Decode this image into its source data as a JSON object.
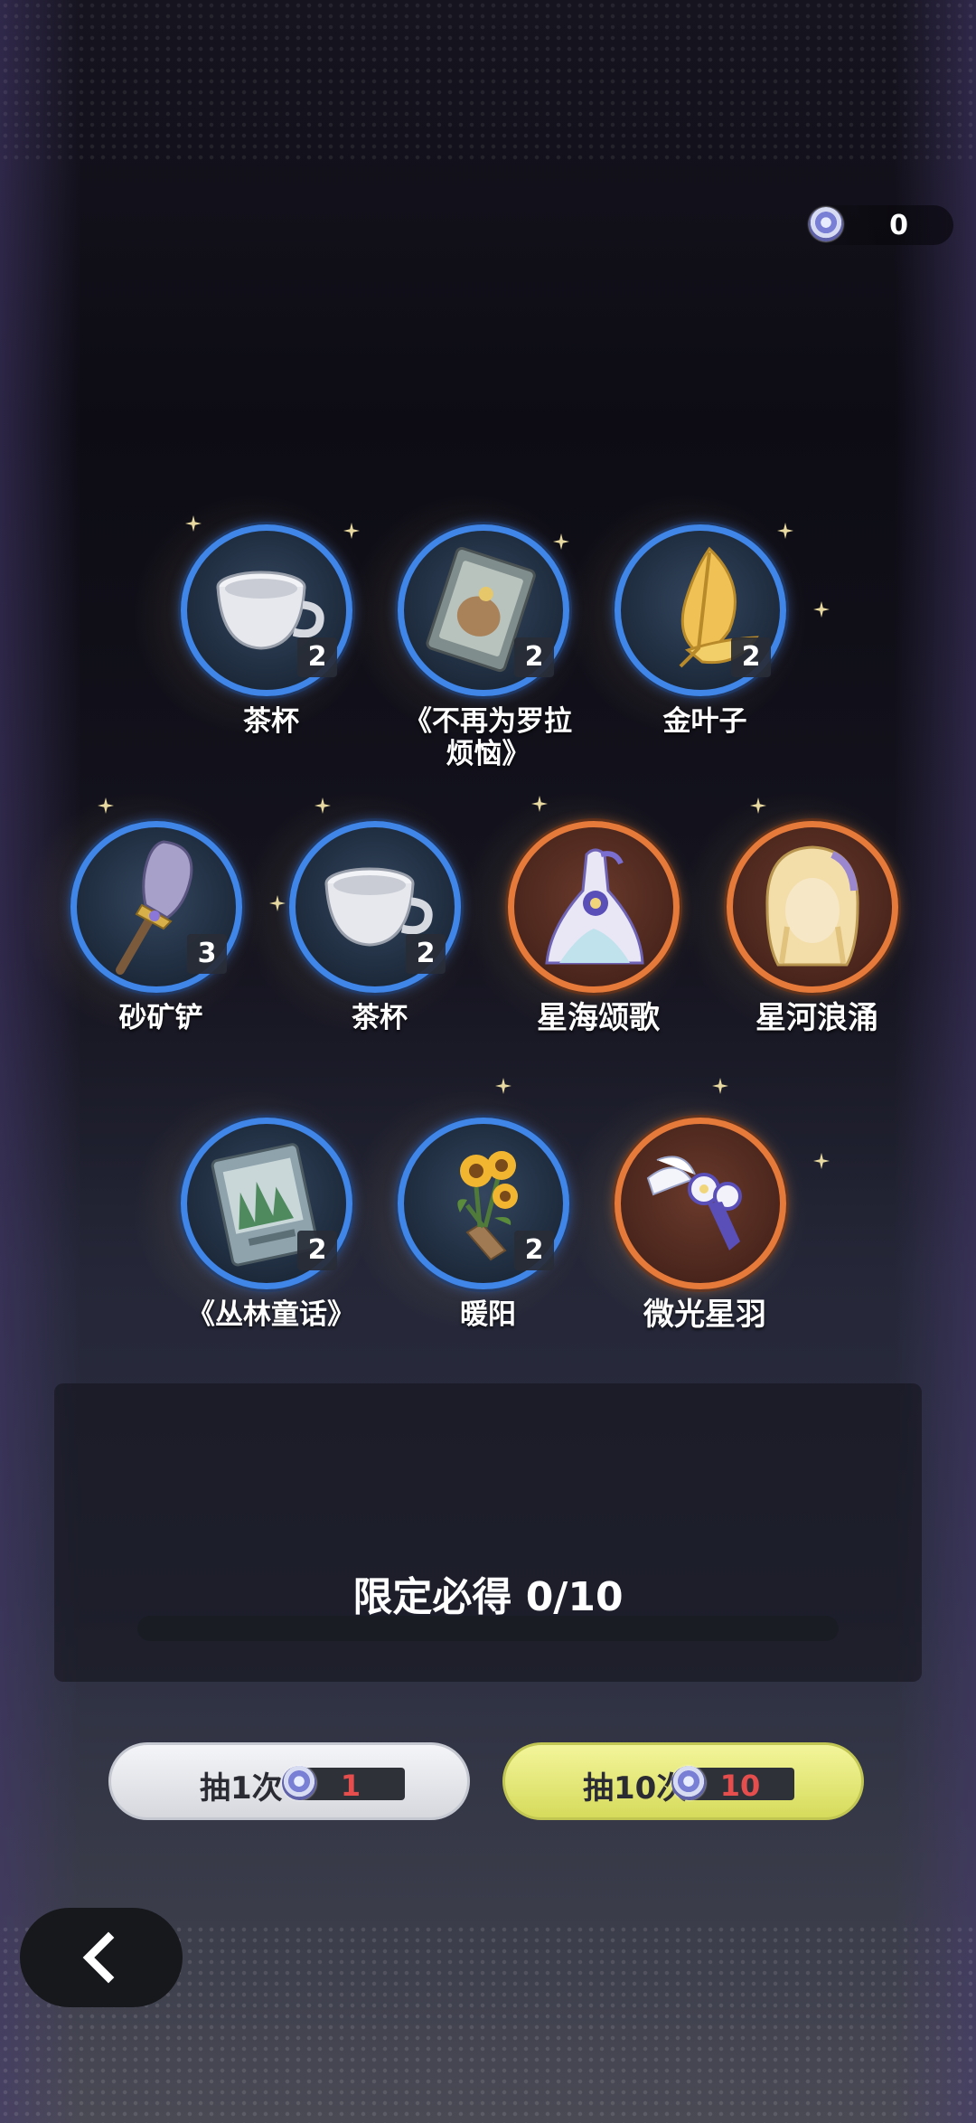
{
  "currency": {
    "amount": "0"
  },
  "items": [
    {
      "name": "茶杯",
      "count": "2",
      "icon": "teacup-icon",
      "rarity": "blue"
    },
    {
      "name": "《不再为罗拉烦恼》",
      "name_line1": "《不再为罗拉",
      "name_line2": "烦恼》",
      "count": "2",
      "icon": "book-icon",
      "rarity": "blue"
    },
    {
      "name": "金叶子",
      "count": "2",
      "icon": "gold-leaf-icon",
      "rarity": "blue"
    },
    {
      "name": "砂矿铲",
      "count": "3",
      "icon": "shovel-icon",
      "rarity": "blue"
    },
    {
      "name": "茶杯",
      "count": "2",
      "icon": "teacup-icon",
      "rarity": "blue"
    },
    {
      "name": "星海颂歌",
      "count": "",
      "icon": "dress-icon",
      "rarity": "orange"
    },
    {
      "name": "星河浪涌",
      "count": "",
      "icon": "hair-icon",
      "rarity": "orange"
    },
    {
      "name": "《丛林童话》",
      "count": "2",
      "icon": "forest-book-icon",
      "rarity": "blue"
    },
    {
      "name": "暖阳",
      "count": "2",
      "icon": "sunflower-bouquet-icon",
      "rarity": "blue"
    },
    {
      "name": "微光星羽",
      "count": "",
      "icon": "hair-accessory-icon",
      "rarity": "orange"
    }
  ],
  "pity": {
    "label": "限定必得 0/10",
    "progress": 0.0
  },
  "buttons": {
    "draw1": {
      "label": "抽1次",
      "cost": "1"
    },
    "draw10": {
      "label": "抽10次",
      "cost": "10"
    }
  },
  "colors": {
    "blue_ring": "#3f86e8",
    "orange_ring": "#e57a3a",
    "cost_text": "#e64d4d",
    "draw10_bg": "#e8ec7c"
  }
}
